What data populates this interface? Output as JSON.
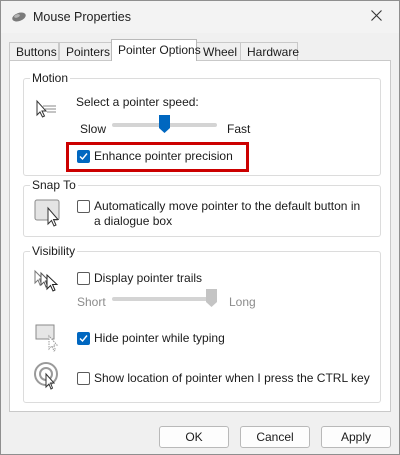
{
  "window": {
    "title": "Mouse Properties"
  },
  "icons": {
    "app": "mouse-icon",
    "close": "close-icon"
  },
  "tabs": [
    {
      "label": "Buttons"
    },
    {
      "label": "Pointers"
    },
    {
      "label": "Pointer Options",
      "active": true
    },
    {
      "label": "Wheel"
    },
    {
      "label": "Hardware"
    }
  ],
  "motion": {
    "title": "Motion",
    "speed_label": "Select a pointer speed:",
    "slow_label": "Slow",
    "fast_label": "Fast",
    "speed_fraction": 0.5,
    "precision_label": "Enhance pointer precision",
    "precision_checked": true
  },
  "snap_to": {
    "title": "Snap To",
    "auto_label": "Automatically move pointer to the default button in a dialogue box",
    "auto_checked": false
  },
  "visibility": {
    "title": "Visibility",
    "trails_label": "Display pointer trails",
    "trails_checked": false,
    "short_label": "Short",
    "long_label": "Long",
    "trails_fraction": 1.0,
    "hide_label": "Hide pointer while typing",
    "hide_checked": true,
    "ctrl_label": "Show location of pointer when I press the CTRL key",
    "ctrl_checked": false
  },
  "buttons": {
    "ok": "OK",
    "cancel": "Cancel",
    "apply": "Apply"
  },
  "colors": {
    "accent": "#0067c0",
    "highlight": "#cc0000"
  }
}
